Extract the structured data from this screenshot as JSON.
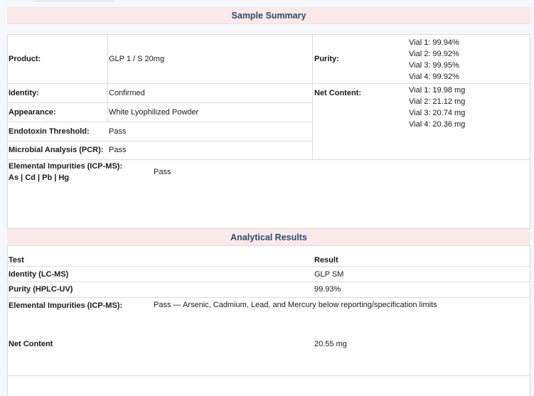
{
  "summary": {
    "title": "Sample Summary",
    "product_label": "Product:",
    "product_value": "GLP 1 / S 20mg",
    "identity_label": "Identity:",
    "identity_value": "Confirmed",
    "appearance_label": "Appearance:",
    "appearance_value": "White Lyophilized Powder",
    "endotoxin_label": "Endotoxin Threshold:",
    "endotoxin_value": "Pass",
    "microbial_label": "Microbial Analysis (PCR):",
    "microbial_value": "Pass",
    "elemental_label_1": "Elemental Impurities (ICP-MS):",
    "elemental_label_2": "As | Cd | Pb | Hg",
    "elemental_value": "Pass",
    "purity_label": "Purity:",
    "purity_values": [
      "Vial 1: 99.94%",
      "Vial 2: 99.92%",
      "Vial 3: 99.95%",
      "Vial 4: 99.92%"
    ],
    "net_label": "Net Content:",
    "net_values": [
      "Vial 1: 19.98 mg",
      "Vial 2: 21.12 mg",
      "Vial 3: 20.74 mg",
      "Vial 4: 20.36 mg"
    ]
  },
  "results": {
    "title": "Analytical Results",
    "col_test": "Test",
    "col_result": "Result",
    "rows": [
      {
        "test": "Identity (LC-MS)",
        "result": "GLP SM"
      },
      {
        "test": "Purity (HPLC-UV)",
        "result": "99.93%"
      },
      {
        "test": "Elemental Impurities (ICP-MS):",
        "result": "Pass — Arsenic, Cadmium, Lead, and Mercury below reporting/specification limits"
      },
      {
        "test": "Net Content",
        "result": "20.55 mg"
      }
    ]
  }
}
